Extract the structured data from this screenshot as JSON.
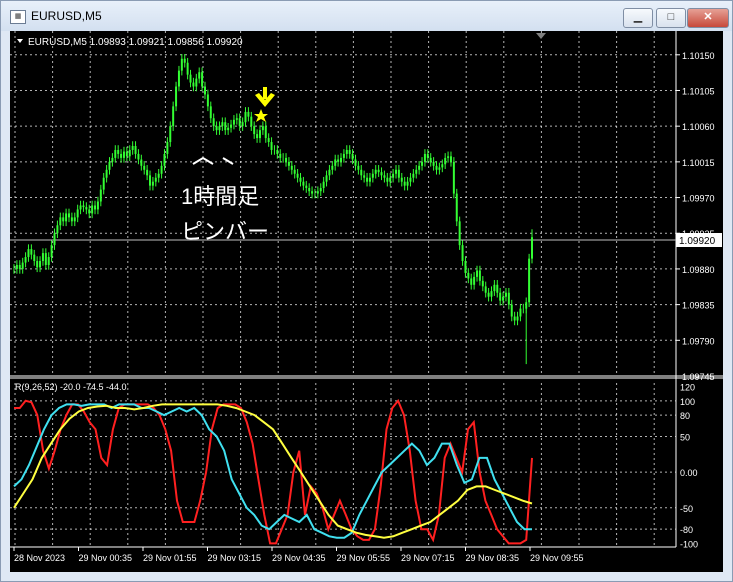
{
  "window": {
    "title": "EURUSD,M5",
    "app_icon": "mt4-chart-icon",
    "buttons": {
      "minimize": "▁",
      "maximize": "□",
      "close": "✕"
    }
  },
  "chart": {
    "header": "EURUSD,M5  1.09893 1.09921 1.09856 1.09920",
    "price_axis": [
      "1.10150",
      "1.10105",
      "1.10060",
      "1.10015",
      "1.09970",
      "1.09925",
      "1.09880",
      "1.09835",
      "1.09790",
      "1.09745"
    ],
    "current_price": "1.09920",
    "annotation_line1": "1時間足",
    "annotation_line2": "ピンバー",
    "colors": {
      "candle": "#33ff33",
      "background": "#000000",
      "grid": "#ffffff",
      "arrow": "#ffff00",
      "red": "#ff2020",
      "cyan": "#40e0f0",
      "yellow": "#ffff40"
    }
  },
  "indicator": {
    "header": "R(9,26,52) -20.0 -74.5 -44.0",
    "axis": [
      "120",
      "100",
      "80",
      "50",
      "0.00",
      "-50",
      "-80",
      "-100"
    ]
  },
  "time_axis": [
    "28 Nov 2023",
    "29 Nov 00:35",
    "29 Nov 01:55",
    "29 Nov 03:15",
    "29 Nov 04:35",
    "29 Nov 05:55",
    "29 Nov 07:15",
    "29 Nov 08:35",
    "29 Nov 09:55"
  ],
  "chart_data": {
    "type": "candlestick",
    "symbol": "EURUSD",
    "timeframe": "M5",
    "ylim": [
      1.09745,
      1.1018
    ],
    "closes": [
      1.0988,
      1.09885,
      1.0988,
      1.09888,
      1.09895,
      1.09905,
      1.09898,
      1.0989,
      1.09882,
      1.0989,
      1.099,
      1.09885,
      1.09895,
      1.0991,
      1.09925,
      1.09935,
      1.09945,
      1.0994,
      1.0995,
      1.09945,
      1.0994,
      1.09945,
      1.09955,
      1.0996,
      1.09958,
      1.09955,
      1.0995,
      1.0996,
      1.09955,
      1.09965,
      1.0998,
      1.09995,
      1.10005,
      1.10015,
      1.1002,
      1.1003,
      1.10025,
      1.1002,
      1.10028,
      1.10022,
      1.1003,
      1.10035,
      1.10025,
      1.10018,
      1.1001,
      1.10005,
      1.09998,
      1.09985,
      1.0999,
      1.09995,
      1.1,
      1.1001,
      1.10025,
      1.1004,
      1.1006,
      1.10085,
      1.1011,
      1.1013,
      1.10145,
      1.1014,
      1.10125,
      1.10115,
      1.1011,
      1.1012,
      1.10128,
      1.1011,
      1.101,
      1.10085,
      1.1007,
      1.1006,
      1.10055,
      1.1006,
      1.10065,
      1.10055,
      1.10058,
      1.10062,
      1.10068,
      1.1007,
      1.1006,
      1.10065,
      1.10078,
      1.10072,
      1.1006,
      1.1005,
      1.10045,
      1.10055,
      1.1006,
      1.10045,
      1.1004,
      1.1003,
      1.1003,
      1.10025,
      1.1002,
      1.1002,
      1.10015,
      1.1001,
      1.10005,
      1.1,
      1.09995,
      1.0999,
      1.09985,
      1.09982,
      1.09978,
      1.09975,
      1.09975,
      1.09978,
      1.09982,
      1.0999,
      1.09998,
      1.10005,
      1.1001,
      1.10018,
      1.10015,
      1.1002,
      1.10025,
      1.1003,
      1.10025,
      1.10018,
      1.1001,
      1.10005,
      1.09998,
      1.09995,
      1.0999,
      1.09995,
      1.1,
      1.10005,
      1.10002,
      1.09998,
      1.09995,
      1.0999,
      1.09995,
      1.1,
      1.10005,
      1.09995,
      1.0999,
      1.09985,
      1.0999,
      1.09995,
      1.1,
      1.10005,
      1.1001,
      1.10015,
      1.10025,
      1.1002,
      1.10015,
      1.1001,
      1.10005,
      1.10008,
      1.10012,
      1.1002,
      1.10022,
      1.10015,
      1.09975,
      1.0994,
      1.0991,
      1.0989,
      1.09875,
      1.09868,
      1.0986,
      1.0987,
      1.09878,
      1.09865,
      1.09858,
      1.0985,
      1.09845,
      1.09852,
      1.0986,
      1.0985,
      1.0984,
      1.09845,
      1.0985,
      1.09835,
      1.0982,
      1.09815,
      1.0982,
      1.0983,
      1.0983,
      1.09838,
      1.09893,
      1.0992
    ],
    "series": [
      {
        "name": "red",
        "values": [
          90,
          90,
          100,
          98,
          80,
          30,
          5,
          30,
          60,
          80,
          95,
          95,
          85,
          70,
          60,
          20,
          10,
          60,
          90,
          95,
          95,
          95,
          95,
          95,
          90,
          80,
          60,
          30,
          -40,
          -70,
          -70,
          -70,
          -40,
          0,
          60,
          90,
          95,
          95,
          95,
          90,
          70,
          40,
          -10,
          -60,
          -100,
          -100,
          -80,
          -60,
          0,
          30,
          -60,
          -20,
          -30,
          -50,
          -80,
          -60,
          -40,
          -60,
          -80,
          -90,
          -95,
          -95,
          -80,
          -20,
          60,
          90,
          100,
          80,
          30,
          -40,
          -80,
          -80,
          -95,
          -60,
          20,
          40,
          20,
          0,
          60,
          70,
          0,
          -40,
          -60,
          -80,
          -90,
          -100,
          -100,
          -100,
          -95,
          20
        ]
      },
      {
        "name": "cyan",
        "values": [
          -20,
          -10,
          10,
          35,
          60,
          80,
          90,
          95,
          95,
          93,
          95,
          95,
          95,
          90,
          95,
          95,
          95,
          90,
          90,
          85,
          80,
          85,
          90,
          85,
          90,
          80,
          60,
          50,
          30,
          -10,
          -30,
          -50,
          -60,
          -75,
          -80,
          -70,
          -60,
          -65,
          -70,
          -60,
          -80,
          -85,
          -90,
          -92,
          -92,
          -85,
          -60,
          -40,
          -20,
          0,
          10,
          20,
          30,
          40,
          30,
          10,
          20,
          40,
          40,
          10,
          -15,
          -10,
          20,
          20,
          -10,
          -30,
          -50,
          -70,
          -80,
          -80
        ]
      },
      {
        "name": "yellow",
        "values": [
          -50,
          -30,
          -10,
          20,
          40,
          60,
          75,
          85,
          90,
          92,
          93,
          90,
          90,
          88,
          90,
          93,
          95,
          95,
          95,
          95,
          95,
          95,
          95,
          93,
          90,
          85,
          80,
          70,
          60,
          40,
          20,
          0,
          -20,
          -40,
          -60,
          -75,
          -80,
          -85,
          -88,
          -90,
          -92,
          -90,
          -85,
          -80,
          -75,
          -70,
          -60,
          -50,
          -40,
          -25,
          -20,
          -20,
          -25,
          -30,
          -35,
          -40,
          -44
        ]
      }
    ],
    "indicator_ylim": [
      -105,
      125
    ]
  }
}
